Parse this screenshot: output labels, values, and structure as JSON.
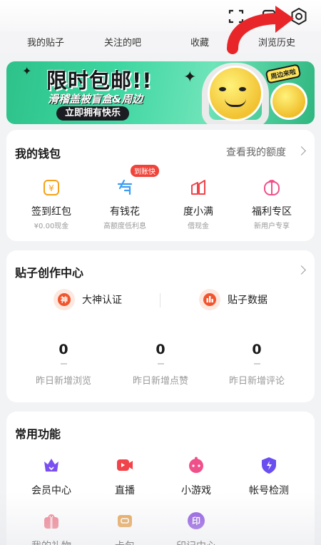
{
  "top_tabs": [
    "我的贴子",
    "关注的吧",
    "收藏",
    "浏览历史"
  ],
  "banner": {
    "title": "限时包邮!!",
    "subtitle": "滑稽盖被盲盒&周边",
    "button": "立即拥有快乐",
    "badge": "周边来啦"
  },
  "wallet": {
    "title": "我的钱包",
    "link": "查看我的额度",
    "tag": "到账快",
    "items": [
      {
        "label": "签到红包",
        "sub": "¥0.00现金",
        "icon": "red-envelope-icon"
      },
      {
        "label": "有钱花",
        "sub": "高额度低利息",
        "icon": "money-icon"
      },
      {
        "label": "度小满",
        "sub": "借现金",
        "icon": "wallet-icon"
      },
      {
        "label": "福利专区",
        "sub": "新用户专享",
        "icon": "gift-icon"
      }
    ]
  },
  "creator": {
    "title": "贴子创作中心",
    "buttons": [
      "大神认证",
      "贴子数据"
    ],
    "badge_char": "神",
    "stats": [
      {
        "value": "0",
        "label": "昨日新增浏览"
      },
      {
        "value": "0",
        "label": "昨日新增点赞"
      },
      {
        "value": "0",
        "label": "昨日新增评论"
      }
    ]
  },
  "functions": {
    "title": "常用功能",
    "items": [
      {
        "label": "会员中心",
        "icon": "crown-icon",
        "color": "#7a4ef0"
      },
      {
        "label": "直播",
        "icon": "video-icon",
        "color": "#f0444a"
      },
      {
        "label": "小游戏",
        "icon": "gamepad-icon",
        "color": "#f0508a"
      },
      {
        "label": "帐号检测",
        "icon": "shield-icon",
        "color": "#6a4ef0"
      },
      {
        "label": "我的礼物",
        "icon": "gift-box-icon",
        "color": "#f07a8a"
      },
      {
        "label": "卡包",
        "icon": "card-icon",
        "color": "#e6a04a"
      },
      {
        "label": "印记中心",
        "icon": "seal-icon",
        "color": "#8a4ee0"
      }
    ],
    "seal_char": "印"
  }
}
